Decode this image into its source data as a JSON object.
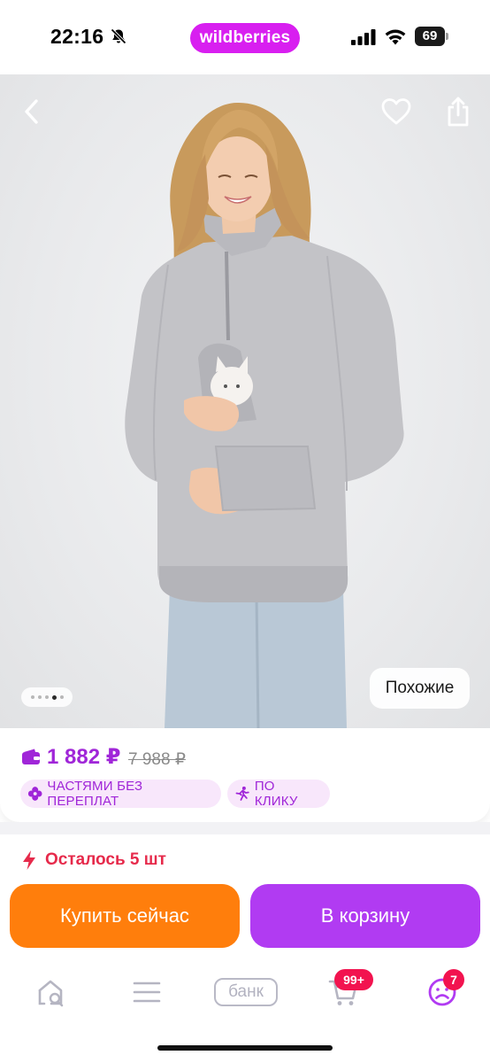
{
  "status_bar": {
    "time": "22:16",
    "app_badge": "wildberries",
    "battery": "69",
    "icons": [
      "bell-slash-icon",
      "signal-icon",
      "wifi-icon",
      "battery-icon"
    ]
  },
  "product_gallery": {
    "total_images": 5,
    "active_index": 3,
    "similar_label": "Похожие",
    "icons": [
      "chevron-left-icon",
      "heart-icon",
      "share-icon"
    ]
  },
  "price": {
    "current": "1 882 ₽",
    "old": "7 988 ₽",
    "wallet_icon": "wallet-icon",
    "chips": [
      {
        "label": "ЧАСТЯМИ БЕЗ ПЕРЕПЛАТ",
        "icon": "parts-icon"
      },
      {
        "label": "ПО КЛИКУ",
        "icon": "running-man-icon"
      }
    ]
  },
  "stock": {
    "text": "Осталось 5 шт",
    "icon": "lightning-icon"
  },
  "actions": {
    "buy_now": "Купить сейчас",
    "add_to_cart": "В корзину"
  },
  "bottom_nav": {
    "items": [
      {
        "name": "home",
        "icon": "home-search-icon"
      },
      {
        "name": "catalog",
        "icon": "menu-icon"
      },
      {
        "name": "bank",
        "label": "банк"
      },
      {
        "name": "cart",
        "icon": "cart-icon",
        "badge": "99+"
      },
      {
        "name": "profile",
        "icon": "profile-icon",
        "badge": "7"
      }
    ]
  },
  "colors": {
    "brand_magenta": "#d81ff0",
    "price_purple": "#a026d8",
    "buy_orange": "#ff7e0c",
    "cart_purple": "#b13bf2",
    "stock_red": "#e62a4b",
    "badge_red": "#f2134f"
  }
}
